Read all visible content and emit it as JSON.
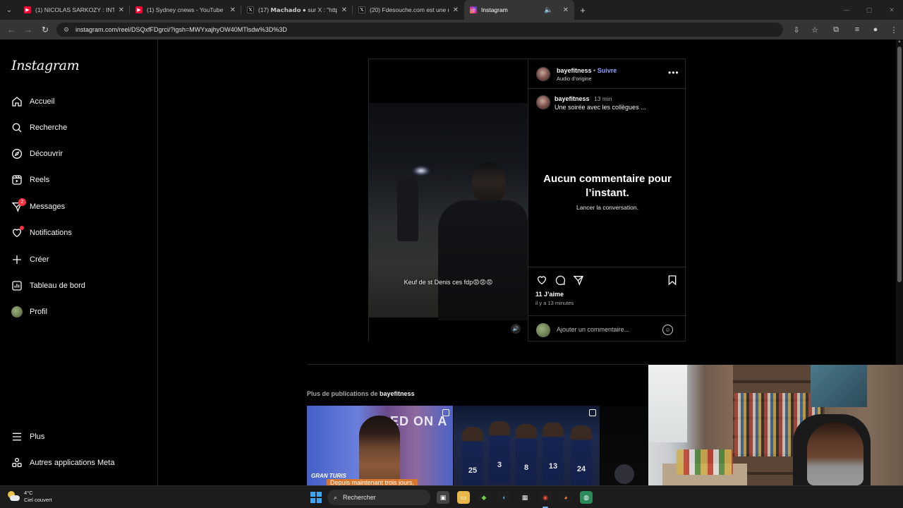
{
  "browser": {
    "tabs": [
      {
        "title": "(1) NICOLAS SARKOZY : INTERV",
        "icon": "youtube-icon",
        "color": "#ff0033"
      },
      {
        "title": "(1) Sydney cnews - YouTube",
        "icon": "youtube-icon",
        "color": "#ff0033"
      },
      {
        "title": "(17) 𝗠𝗮𝗰𝗵𝗮𝗱𝗼 ● sur X : \"https:",
        "icon": "x-icon",
        "color": "#000000"
      },
      {
        "title": "(20) Fdesouche.com est une rev",
        "icon": "x-icon",
        "color": "#000000"
      },
      {
        "title": "Instagram",
        "icon": "instagram-icon",
        "color": "#d6249f",
        "active": true
      }
    ],
    "url": "instagram.com/reel/DSQxfFDgrci/?igsh=MWYxajhyOW40MTlsdw%3D%3D"
  },
  "instagram": {
    "logo": "Instagram",
    "nav": [
      {
        "label": "Accueil",
        "icon": "home-icon"
      },
      {
        "label": "Recherche",
        "icon": "search-icon"
      },
      {
        "label": "Découvrir",
        "icon": "compass-icon"
      },
      {
        "label": "Reels",
        "icon": "reels-icon"
      },
      {
        "label": "Messages",
        "icon": "messenger-icon",
        "badge": "2"
      },
      {
        "label": "Notifications",
        "icon": "heart-icon"
      },
      {
        "label": "Créer",
        "icon": "plus-icon"
      },
      {
        "label": "Tableau de bord",
        "icon": "dashboard-icon"
      },
      {
        "label": "Profil",
        "icon": "avatar"
      }
    ],
    "bottom_nav": [
      {
        "label": "Plus",
        "icon": "menu-icon"
      },
      {
        "label": "Autres applications Meta",
        "icon": "meta-apps-icon"
      }
    ],
    "post": {
      "username": "bayefitness",
      "separator": "•",
      "follow": "Suivre",
      "audio": "Audio d’origine",
      "caption_user": "bayefitness",
      "caption_time": "13 min",
      "caption": "Une soirée avec les collègues ...",
      "video_caption": "Keuf de st Denis ces fdp😡😡😡",
      "no_comments": "Aucun commentaire pour l’instant.",
      "start_conversation": "Lancer la conversation.",
      "likes": "11 J’aime",
      "posted_ago": "il y a 13 minutes",
      "comment_placeholder": "Ajouter un commentaire..."
    },
    "more_posts": {
      "prefix": "Plus de publications de",
      "user": "bayefitness",
      "thumb1_big": "ED ON A",
      "thumb1_brand": "GRAN TURIS",
      "thumb1_overlay": "Depuis maintenant trois jours,",
      "player_numbers": [
        "25",
        "3",
        "8",
        "13",
        "24"
      ]
    }
  },
  "taskbar": {
    "temperature": "4°C",
    "weather": "Ciel couvert",
    "search": "Rechercher"
  }
}
